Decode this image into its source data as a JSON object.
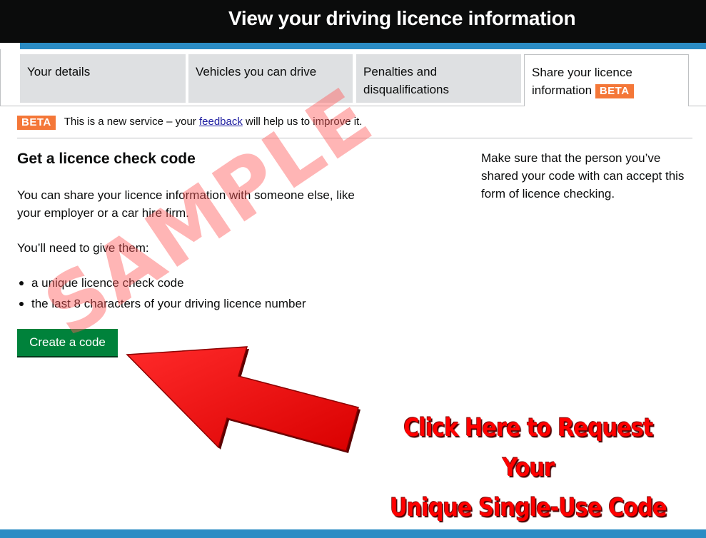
{
  "header": {
    "title": "View your driving licence information"
  },
  "tabs": [
    {
      "label": "Your details"
    },
    {
      "label": "Vehicles you can drive"
    },
    {
      "label": "Penalties and disqualifications"
    },
    {
      "label": "Share your licence information",
      "tag": "BETA",
      "active": true
    }
  ],
  "phase_banner": {
    "tag": "BETA",
    "text_before": "This is a new service – your",
    "link": "feedback",
    "text_after": "will help us to improve it."
  },
  "main": {
    "heading": "Get a licence check code",
    "intro": "You can share your licence information with someone else, like your employer or a car hire firm.",
    "need_text": "You’ll need to give them:",
    "bullets": [
      "a unique licence check code",
      "the last 8 characters of your driving licence number"
    ],
    "button_label": "Create a code"
  },
  "sidebar": {
    "text": "Make sure that the person you’ve shared your code with can accept this form of licence checking."
  },
  "overlay": {
    "watermark": "SAMPLE",
    "callout_line1": "Click Here to Request Your",
    "callout_line2": "Unique Single-Use Code"
  },
  "colors": {
    "header_bg": "#0b0c0c",
    "accent_blue": "#2b8cc4",
    "beta_orange": "#f47738",
    "button_green": "#00823b",
    "link_blue": "#1d1da0",
    "arrow_red": "#ff0000"
  }
}
